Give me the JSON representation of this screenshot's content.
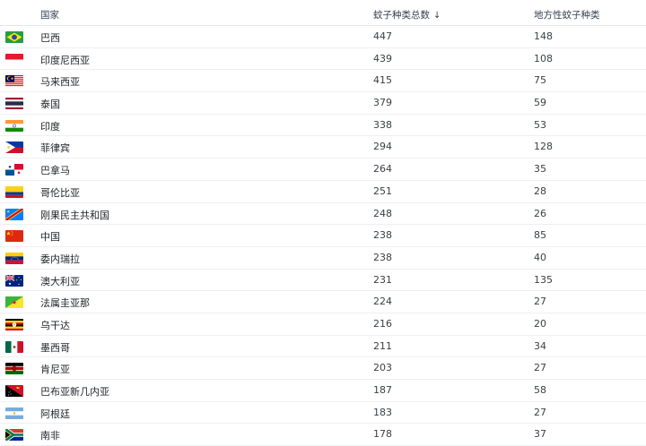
{
  "table": {
    "headers": {
      "country": "国家",
      "total": "蚊子种类总数",
      "sort_indicator": "↓",
      "endemic": "地方性蚊子种类"
    },
    "rows": [
      {
        "country": "巴西",
        "total": "447",
        "endemic": "148",
        "flag": "brazil-flag-icon"
      },
      {
        "country": "印度尼西亚",
        "total": "439",
        "endemic": "108",
        "flag": "indonesia-flag-icon"
      },
      {
        "country": "马来西亚",
        "total": "415",
        "endemic": "75",
        "flag": "malaysia-flag-icon"
      },
      {
        "country": "泰国",
        "total": "379",
        "endemic": "59",
        "flag": "thailand-flag-icon"
      },
      {
        "country": "印度",
        "total": "338",
        "endemic": "53",
        "flag": "india-flag-icon"
      },
      {
        "country": "菲律宾",
        "total": "294",
        "endemic": "128",
        "flag": "philippines-flag-icon"
      },
      {
        "country": "巴拿马",
        "total": "264",
        "endemic": "35",
        "flag": "panama-flag-icon"
      },
      {
        "country": "哥伦比亚",
        "total": "251",
        "endemic": "28",
        "flag": "colombia-flag-icon"
      },
      {
        "country": "刚果民主共和国",
        "total": "248",
        "endemic": "26",
        "flag": "dr-congo-flag-icon"
      },
      {
        "country": "中国",
        "total": "238",
        "endemic": "85",
        "flag": "china-flag-icon"
      },
      {
        "country": "委内瑞拉",
        "total": "238",
        "endemic": "40",
        "flag": "venezuela-flag-icon"
      },
      {
        "country": "澳大利亚",
        "total": "231",
        "endemic": "135",
        "flag": "australia-flag-icon"
      },
      {
        "country": "法属圭亚那",
        "total": "224",
        "endemic": "27",
        "flag": "french-guiana-flag-icon"
      },
      {
        "country": "乌干达",
        "total": "216",
        "endemic": "20",
        "flag": "uganda-flag-icon"
      },
      {
        "country": "墨西哥",
        "total": "211",
        "endemic": "34",
        "flag": "mexico-flag-icon"
      },
      {
        "country": "肯尼亚",
        "total": "203",
        "endemic": "27",
        "flag": "kenya-flag-icon"
      },
      {
        "country": "巴布亚新几内亚",
        "total": "187",
        "endemic": "58",
        "flag": "papua-new-guinea-flag-icon"
      },
      {
        "country": "阿根廷",
        "total": "183",
        "endemic": "27",
        "flag": "argentina-flag-icon"
      },
      {
        "country": "南非",
        "total": "178",
        "endemic": "37",
        "flag": "south-africa-flag-icon"
      }
    ]
  }
}
